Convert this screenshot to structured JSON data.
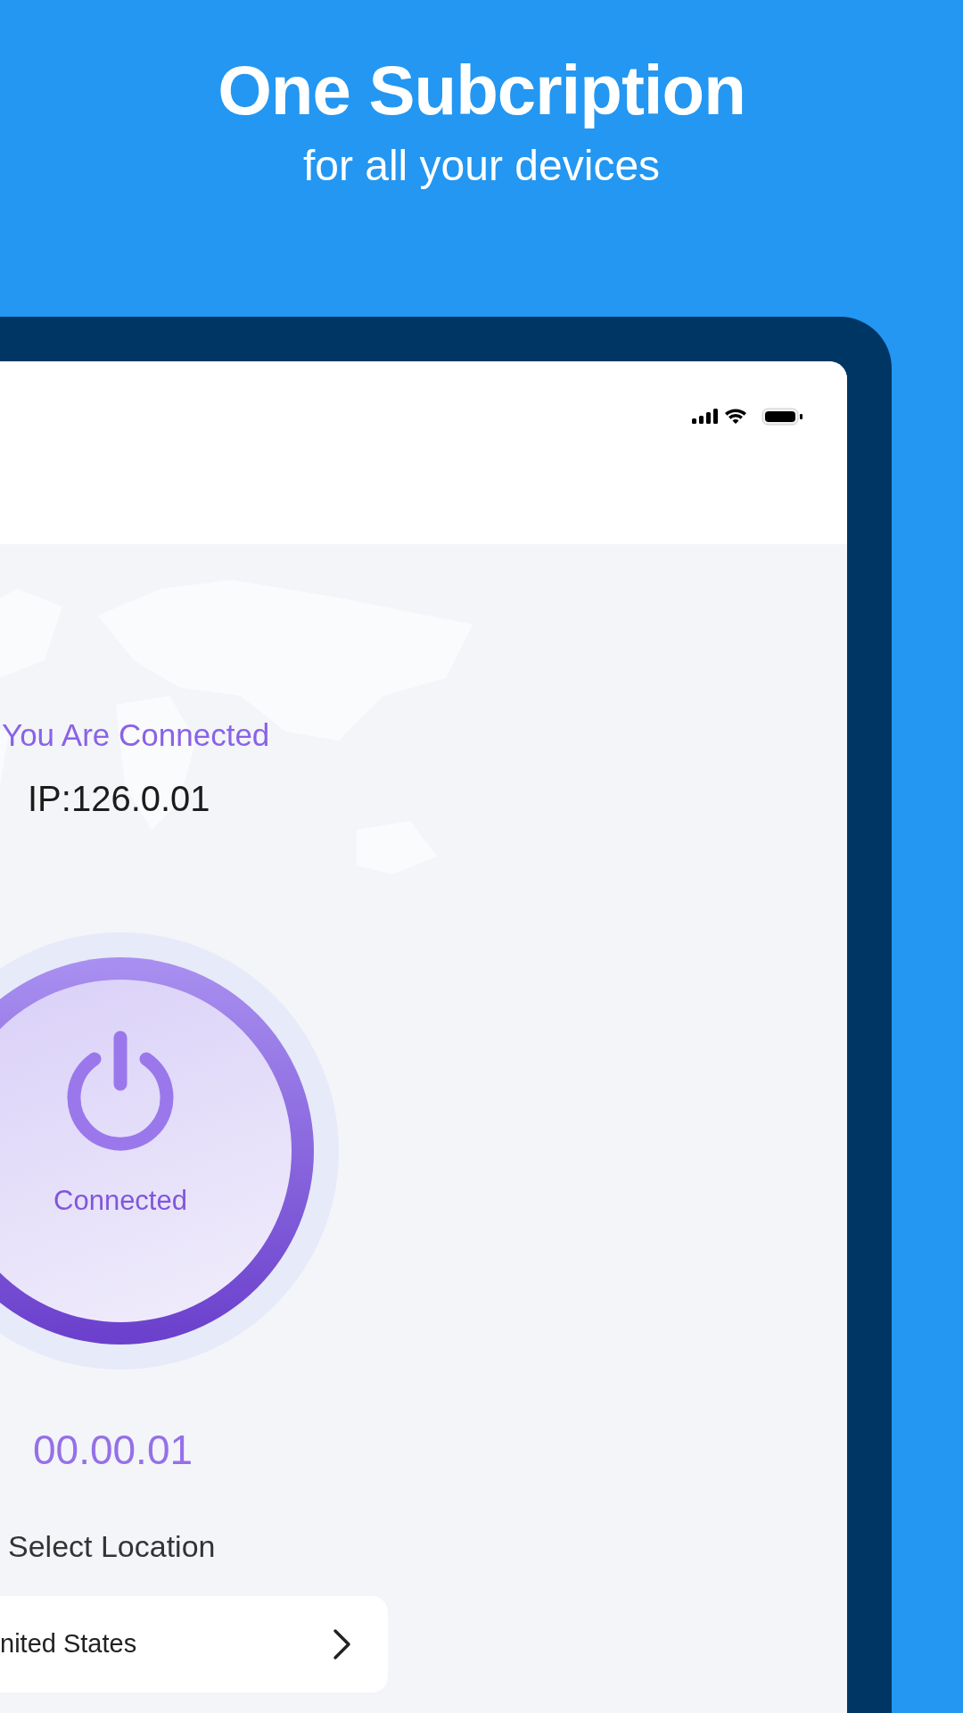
{
  "banner": {
    "title": "One Subcription",
    "subtitle": "for all your devices"
  },
  "status": {
    "connected_label": "You Are Connected",
    "ip": "IP:126.0.01",
    "button_label": "Connected",
    "connected": true,
    "timer": "00.00.01"
  },
  "location": {
    "heading": "Select Location",
    "country": "nited States"
  }
}
